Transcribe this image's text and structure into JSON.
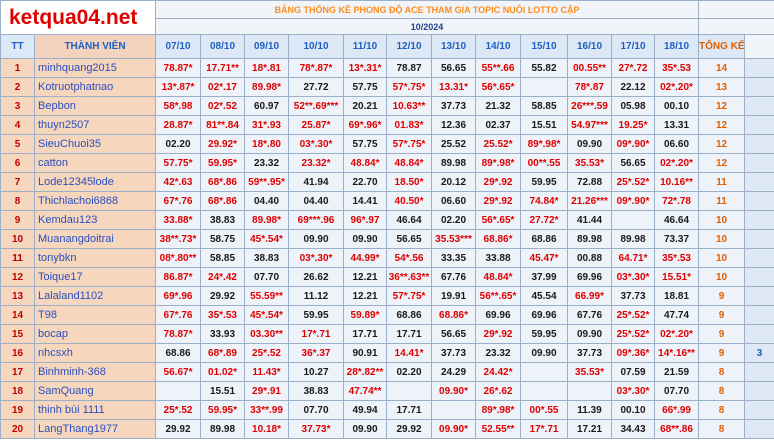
{
  "header": {
    "logo_text": "ketqua04.net",
    "banner_title": "BẢNG THỐNG KÊ PHONG ĐỘ ACE THAM GIA TOPIC NUÔI LOTTO CẶP",
    "month": "10/2024",
    "columns": {
      "tt": "TT",
      "member": "THÀNH VIÊN",
      "dates": [
        "07/10",
        "08/10",
        "09/10",
        "10/10",
        "11/10",
        "12/10",
        "13/10",
        "14/10",
        "15/10",
        "16/10",
        "17/10",
        "18/10"
      ],
      "total": "TỔNG KẾT"
    }
  },
  "rows": [
    {
      "tt": "1",
      "name": "minhquang2015",
      "cells": [
        [
          "78.87*",
          "r"
        ],
        [
          "17.71**",
          "r"
        ],
        [
          "18*.81",
          "r"
        ],
        [
          "78*.87*",
          "r"
        ],
        [
          "13*.31*",
          "r"
        ],
        [
          "78.87",
          "b"
        ],
        [
          "56.65",
          "b"
        ],
        [
          "55**.66",
          "r"
        ],
        [
          "55.82",
          "b"
        ],
        [
          "00.55**",
          "r"
        ],
        [
          "27*.72",
          "r"
        ],
        [
          "35*.53",
          "r"
        ]
      ],
      "total": "14",
      "extra": ""
    },
    {
      "tt": "2",
      "name": "Kotruotphatnao",
      "cells": [
        [
          "13*.87*",
          "r"
        ],
        [
          "02*.17",
          "r"
        ],
        [
          "89.98*",
          "r"
        ],
        [
          "27.72",
          "b"
        ],
        [
          "57.75",
          "b"
        ],
        [
          "57*.75*",
          "r"
        ],
        [
          "13.31*",
          "r"
        ],
        [
          "56*.65*",
          "r"
        ],
        [
          "",
          ""
        ],
        [
          "78*.87",
          "r"
        ],
        [
          "22.12",
          "b"
        ],
        [
          "02*.20*",
          "r"
        ]
      ],
      "total": "13",
      "extra": ""
    },
    {
      "tt": "3",
      "name": "Bepbon",
      "cells": [
        [
          "58*.98",
          "r"
        ],
        [
          "02*.52",
          "r"
        ],
        [
          "60.97",
          "b"
        ],
        [
          "52**.69***",
          "r"
        ],
        [
          "20.21",
          "b"
        ],
        [
          "10.63**",
          "r"
        ],
        [
          "37.73",
          "b"
        ],
        [
          "21.32",
          "b"
        ],
        [
          "58.85",
          "b"
        ],
        [
          "26***.59",
          "r"
        ],
        [
          "05.98",
          "b"
        ],
        [
          "00.10",
          "b"
        ]
      ],
      "total": "12",
      "extra": ""
    },
    {
      "tt": "4",
      "name": "thuyn2507",
      "cells": [
        [
          "28.87*",
          "r"
        ],
        [
          "81**.84",
          "r"
        ],
        [
          "31*.93",
          "r"
        ],
        [
          "25.87*",
          "r"
        ],
        [
          "69*.96*",
          "r"
        ],
        [
          "01.83*",
          "r"
        ],
        [
          "12.36",
          "b"
        ],
        [
          "02.37",
          "b"
        ],
        [
          "15.51",
          "b"
        ],
        [
          "54.97***",
          "r"
        ],
        [
          "19.25*",
          "r"
        ],
        [
          "13.31",
          "b"
        ]
      ],
      "total": "12",
      "extra": ""
    },
    {
      "tt": "5",
      "name": "SieuChuoi35",
      "cells": [
        [
          "02.20",
          "b"
        ],
        [
          "29.92*",
          "r"
        ],
        [
          "18*.80",
          "r"
        ],
        [
          "03*.30*",
          "r"
        ],
        [
          "57.75",
          "b"
        ],
        [
          "57*.75*",
          "r"
        ],
        [
          "25.52",
          "b"
        ],
        [
          "25.52*",
          "r"
        ],
        [
          "89*.98*",
          "r"
        ],
        [
          "09.90",
          "b"
        ],
        [
          "09*.90*",
          "r"
        ],
        [
          "06.60",
          "b"
        ]
      ],
      "total": "12",
      "extra": ""
    },
    {
      "tt": "6",
      "name": "catton",
      "cells": [
        [
          "57.75*",
          "r"
        ],
        [
          "59.95*",
          "r"
        ],
        [
          "23.32",
          "b"
        ],
        [
          "23.32*",
          "r"
        ],
        [
          "48.84*",
          "r"
        ],
        [
          "48.84*",
          "r"
        ],
        [
          "89.98",
          "b"
        ],
        [
          "89*.98*",
          "r"
        ],
        [
          "00**.55",
          "r"
        ],
        [
          "35.53*",
          "r"
        ],
        [
          "56.65",
          "b"
        ],
        [
          "02*.20*",
          "r"
        ]
      ],
      "total": "12",
      "extra": ""
    },
    {
      "tt": "7",
      "name": "Lode12345lode",
      "cells": [
        [
          "42*.63",
          "r"
        ],
        [
          "68*.86",
          "r"
        ],
        [
          "59**.95*",
          "r"
        ],
        [
          "41.94",
          "b"
        ],
        [
          "22.70",
          "b"
        ],
        [
          "18.50*",
          "r"
        ],
        [
          "20.12",
          "b"
        ],
        [
          "29*.92",
          "r"
        ],
        [
          "59.95",
          "b"
        ],
        [
          "72.88",
          "b"
        ],
        [
          "25*.52*",
          "r"
        ],
        [
          "10.16**",
          "r"
        ]
      ],
      "total": "11",
      "extra": ""
    },
    {
      "tt": "8",
      "name": "Thichlachoi6868",
      "cells": [
        [
          "67*.76",
          "r"
        ],
        [
          "68*.86",
          "r"
        ],
        [
          "04.40",
          "b"
        ],
        [
          "04.40",
          "b"
        ],
        [
          "14.41",
          "b"
        ],
        [
          "40.50*",
          "r"
        ],
        [
          "06.60",
          "b"
        ],
        [
          "29*.92",
          "r"
        ],
        [
          "74.84*",
          "r"
        ],
        [
          "21.26***",
          "r"
        ],
        [
          "09*.90*",
          "r"
        ],
        [
          "72*.78",
          "r"
        ]
      ],
      "total": "11",
      "extra": ""
    },
    {
      "tt": "9",
      "name": "Kemdau123",
      "cells": [
        [
          "33.88*",
          "r"
        ],
        [
          "38.83",
          "b"
        ],
        [
          "89.98*",
          "r"
        ],
        [
          "69***.96",
          "r"
        ],
        [
          "96*.97",
          "r"
        ],
        [
          "46.64",
          "b"
        ],
        [
          "02.20",
          "b"
        ],
        [
          "56*.65*",
          "r"
        ],
        [
          "27.72*",
          "r"
        ],
        [
          "41.44",
          "b"
        ],
        [
          "",
          ""
        ],
        [
          "46.64",
          "b"
        ]
      ],
      "total": "10",
      "extra": ""
    },
    {
      "tt": "10",
      "name": "Muanangdoitrai",
      "cells": [
        [
          "38**.73*",
          "r"
        ],
        [
          "58.75",
          "b"
        ],
        [
          "45*.54*",
          "r"
        ],
        [
          "09.90",
          "b"
        ],
        [
          "09.90",
          "b"
        ],
        [
          "56.65",
          "b"
        ],
        [
          "35.53***",
          "r"
        ],
        [
          "68.86*",
          "r"
        ],
        [
          "68.86",
          "b"
        ],
        [
          "89.98",
          "b"
        ],
        [
          "89.98",
          "b"
        ],
        [
          "73.37",
          "b"
        ]
      ],
      "total": "10",
      "extra": ""
    },
    {
      "tt": "11",
      "name": "tonybkn",
      "cells": [
        [
          "08*.80**",
          "r"
        ],
        [
          "58.85",
          "b"
        ],
        [
          "38.83",
          "b"
        ],
        [
          "03*.30*",
          "r"
        ],
        [
          "44.99*",
          "r"
        ],
        [
          "54*.56",
          "r"
        ],
        [
          "33.35",
          "b"
        ],
        [
          "33.88",
          "b"
        ],
        [
          "45.47*",
          "r"
        ],
        [
          "00.88",
          "b"
        ],
        [
          "64.71*",
          "r"
        ],
        [
          "35*.53",
          "r"
        ]
      ],
      "total": "10",
      "extra": ""
    },
    {
      "tt": "12",
      "name": "Toique17",
      "cells": [
        [
          "86.87*",
          "r"
        ],
        [
          "24*.42",
          "r"
        ],
        [
          "07.70",
          "b"
        ],
        [
          "26.62",
          "b"
        ],
        [
          "12.21",
          "b"
        ],
        [
          "36**.63**",
          "r"
        ],
        [
          "67.76",
          "b"
        ],
        [
          "48.84*",
          "r"
        ],
        [
          "37.99",
          "b"
        ],
        [
          "69.96",
          "b"
        ],
        [
          "03*.30*",
          "r"
        ],
        [
          "15.51*",
          "r"
        ]
      ],
      "total": "10",
      "extra": ""
    },
    {
      "tt": "13",
      "name": "Lalaland1102",
      "cells": [
        [
          "69*.96",
          "r"
        ],
        [
          "29.92",
          "b"
        ],
        [
          "55.59**",
          "r"
        ],
        [
          "11.12",
          "b"
        ],
        [
          "12.21",
          "b"
        ],
        [
          "57*.75*",
          "r"
        ],
        [
          "19.91",
          "b"
        ],
        [
          "56**.65*",
          "r"
        ],
        [
          "45.54",
          "b"
        ],
        [
          "66.99*",
          "r"
        ],
        [
          "37.73",
          "b"
        ],
        [
          "18.81",
          "b"
        ]
      ],
      "total": "9",
      "extra": ""
    },
    {
      "tt": "14",
      "name": "T98",
      "cells": [
        [
          "67*.76",
          "r"
        ],
        [
          "35*.53",
          "r"
        ],
        [
          "45*.54*",
          "r"
        ],
        [
          "59.95",
          "b"
        ],
        [
          "59.89*",
          "r"
        ],
        [
          "68.86",
          "b"
        ],
        [
          "68.86*",
          "r"
        ],
        [
          "69.96",
          "b"
        ],
        [
          "69.96",
          "b"
        ],
        [
          "67.76",
          "b"
        ],
        [
          "25*.52*",
          "r"
        ],
        [
          "47.74",
          "b"
        ]
      ],
      "total": "9",
      "extra": ""
    },
    {
      "tt": "15",
      "name": "bocap",
      "cells": [
        [
          "78.87*",
          "r"
        ],
        [
          "33.93",
          "b"
        ],
        [
          "03.30**",
          "r"
        ],
        [
          "17*.71",
          "r"
        ],
        [
          "17.71",
          "b"
        ],
        [
          "17.71",
          "b"
        ],
        [
          "56.65",
          "b"
        ],
        [
          "29*.92",
          "r"
        ],
        [
          "59.95",
          "b"
        ],
        [
          "09.90",
          "b"
        ],
        [
          "25*.52*",
          "r"
        ],
        [
          "02*.20*",
          "r"
        ]
      ],
      "total": "9",
      "extra": ""
    },
    {
      "tt": "16",
      "name": "nhcsxh",
      "cells": [
        [
          "68.86",
          "b"
        ],
        [
          "68*.89",
          "r"
        ],
        [
          "25*.52",
          "r"
        ],
        [
          "36*.37",
          "r"
        ],
        [
          "90.91",
          "b"
        ],
        [
          "14.41*",
          "r"
        ],
        [
          "37.73",
          "b"
        ],
        [
          "23.32",
          "b"
        ],
        [
          "09.90",
          "b"
        ],
        [
          "37.73",
          "b"
        ],
        [
          "09*.36*",
          "r"
        ],
        [
          "14*.16**",
          "r"
        ]
      ],
      "total": "9",
      "extra": "3"
    },
    {
      "tt": "17",
      "name": "Binhminh-368",
      "cells": [
        [
          "56.67*",
          "r"
        ],
        [
          "01.02*",
          "r"
        ],
        [
          "11.43*",
          "r"
        ],
        [
          "10.27",
          "b"
        ],
        [
          "28*.82**",
          "r"
        ],
        [
          "02.20",
          "b"
        ],
        [
          "24.29",
          "b"
        ],
        [
          "24.42*",
          "r"
        ],
        [
          "",
          ""
        ],
        [
          "35.53*",
          "r"
        ],
        [
          "07.59",
          "b"
        ],
        [
          "21.59",
          "b"
        ]
      ],
      "total": "8",
      "extra": ""
    },
    {
      "tt": "18",
      "name": "SamQuang",
      "cells": [
        [
          "",
          ""
        ],
        [
          "15.51",
          "b"
        ],
        [
          "29*.91",
          "r"
        ],
        [
          "38.83",
          "b"
        ],
        [
          "47.74**",
          "r"
        ],
        [
          "",
          ""
        ],
        [
          "09.90*",
          "r"
        ],
        [
          "26*.62",
          "r"
        ],
        [
          "",
          ""
        ],
        [
          "",
          ""
        ],
        [
          "03*.30*",
          "r"
        ],
        [
          "07.70",
          "b"
        ]
      ],
      "total": "8",
      "extra": ""
    },
    {
      "tt": "19",
      "name": "thinh bùi 1111",
      "cells": [
        [
          "25*.52",
          "r"
        ],
        [
          "59.95*",
          "r"
        ],
        [
          "33**.99",
          "r"
        ],
        [
          "07.70",
          "b"
        ],
        [
          "49.94",
          "b"
        ],
        [
          "17.71",
          "b"
        ],
        [
          "",
          ""
        ],
        [
          "89*.98*",
          "r"
        ],
        [
          "00*.55",
          "r"
        ],
        [
          "11.39",
          "b"
        ],
        [
          "00.10",
          "b"
        ],
        [
          "66*.99",
          "r"
        ]
      ],
      "total": "8",
      "extra": ""
    },
    {
      "tt": "20",
      "name": "LangThang1977",
      "cells": [
        [
          "29.92",
          "b"
        ],
        [
          "89.98",
          "b"
        ],
        [
          "10.18*",
          "r"
        ],
        [
          "37.73*",
          "r"
        ],
        [
          "09.90",
          "b"
        ],
        [
          "29.92",
          "b"
        ],
        [
          "09.90*",
          "r"
        ],
        [
          "52.55**",
          "r"
        ],
        [
          "17*.71",
          "r"
        ],
        [
          "17.21",
          "b"
        ],
        [
          "34.43",
          "b"
        ],
        [
          "68**.86",
          "r"
        ]
      ],
      "total": "8",
      "extra": ""
    }
  ]
}
